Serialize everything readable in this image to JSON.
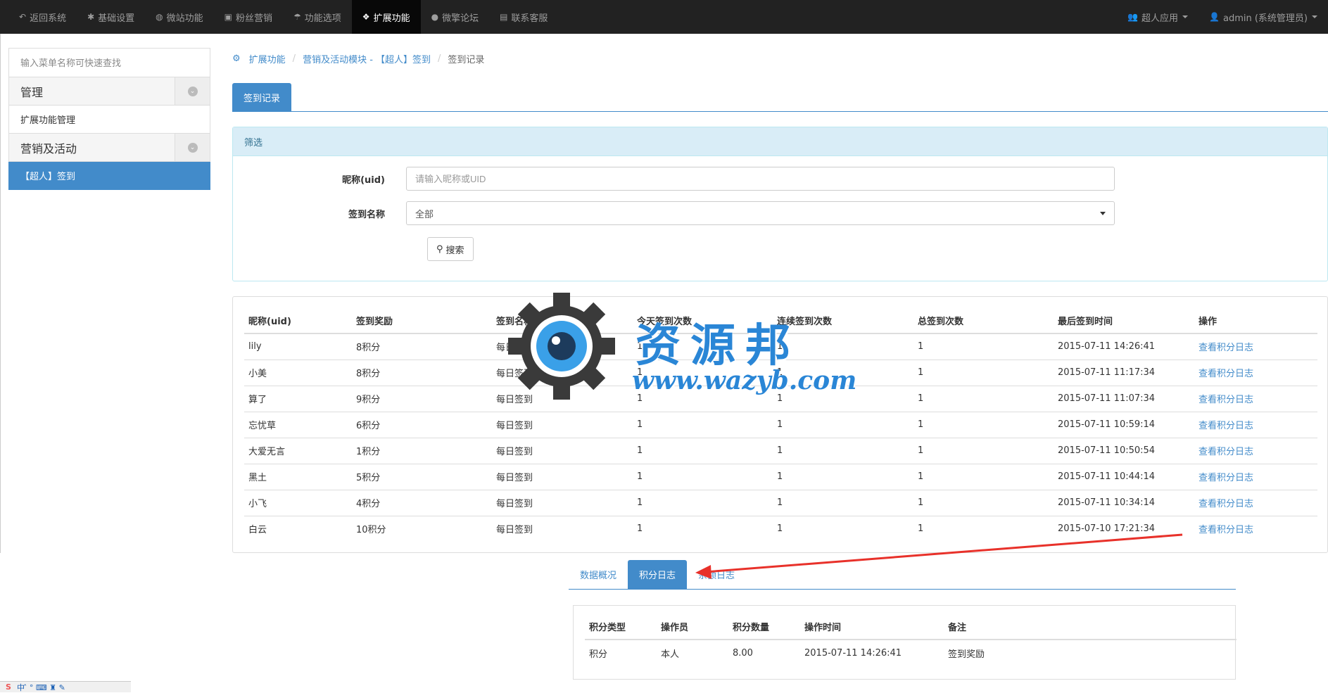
{
  "navbar": {
    "items": [
      {
        "icon": "reply-icon",
        "glyph": "↶",
        "label": "返回系统"
      },
      {
        "icon": "cog-icon",
        "glyph": "✱",
        "label": "基础设置"
      },
      {
        "icon": "globe-icon",
        "glyph": "◍",
        "label": "微站功能"
      },
      {
        "icon": "gift-icon",
        "glyph": "▣",
        "label": "粉丝营销"
      },
      {
        "icon": "umbrella-icon",
        "glyph": "☂",
        "label": "功能选项"
      },
      {
        "icon": "cubes-icon",
        "glyph": "❖",
        "label": "扩展功能"
      },
      {
        "icon": "comment-icon",
        "glyph": "●",
        "label": "微擎论坛"
      },
      {
        "icon": "briefcase-icon",
        "glyph": "▤",
        "label": "联系客服"
      }
    ],
    "active_index": 5,
    "right": {
      "app_label": "超人应用",
      "user_label": "admin (系统管理员)"
    }
  },
  "sidebar": {
    "search_placeholder": "输入菜单名称可快速查找",
    "groups": [
      {
        "title": "管理",
        "items": [
          {
            "label": "扩展功能管理",
            "active": false
          }
        ]
      },
      {
        "title": "营销及活动",
        "items": [
          {
            "label": "【超人】签到",
            "active": true
          }
        ]
      }
    ]
  },
  "breadcrumb": {
    "items": [
      "扩展功能",
      "营销及活动模块 - 【超人】签到"
    ],
    "current": "签到记录"
  },
  "tab": {
    "label": "签到记录"
  },
  "filter": {
    "heading": "筛选",
    "nickname_label": "昵称(uid)",
    "nickname_placeholder": "请输入昵称或UID",
    "name_label": "签到名称",
    "name_value": "全部",
    "search_button": "搜索"
  },
  "records": {
    "columns": [
      "昵称(uid)",
      "签到奖励",
      "签到名称",
      "今天签到次数",
      "连续签到次数",
      "总签到次数",
      "最后签到时间",
      "操作"
    ],
    "rows": [
      [
        "lily",
        "8积分",
        "每日签到",
        "1",
        "1",
        "1",
        "2015-07-11 14:26:41",
        "查看积分日志"
      ],
      [
        "小美",
        "8积分",
        "每日签到",
        "1",
        "1",
        "1",
        "2015-07-11 11:17:34",
        "查看积分日志"
      ],
      [
        "算了",
        "9积分",
        "每日签到",
        "1",
        "1",
        "1",
        "2015-07-11 11:07:34",
        "查看积分日志"
      ],
      [
        "忘忧草",
        "6积分",
        "每日签到",
        "1",
        "1",
        "1",
        "2015-07-11 10:59:14",
        "查看积分日志"
      ],
      [
        "大爱无言",
        "1积分",
        "每日签到",
        "1",
        "1",
        "1",
        "2015-07-11 10:50:54",
        "查看积分日志"
      ],
      [
        "黑土",
        "5积分",
        "每日签到",
        "1",
        "1",
        "1",
        "2015-07-11 10:44:14",
        "查看积分日志"
      ],
      [
        "小飞",
        "4积分",
        "每日签到",
        "1",
        "1",
        "1",
        "2015-07-11 10:34:14",
        "查看积分日志"
      ],
      [
        "白云",
        "10积分",
        "每日签到",
        "1",
        "1",
        "1",
        "2015-07-10 17:21:34",
        "查看积分日志"
      ]
    ]
  },
  "credit_log": {
    "tabs": [
      "数据概况",
      "积分日志",
      "余额日志"
    ],
    "active_tab": 1,
    "columns": [
      "积分类型",
      "操作员",
      "积分数量",
      "操作时间",
      "备注"
    ],
    "rows": [
      [
        "积分",
        "本人",
        "8.00",
        "2015-07-11 14:26:41",
        "签到奖励"
      ]
    ]
  },
  "watermark": {
    "title": "资源邦",
    "url": "www.wazyb.com"
  },
  "ime": {
    "text": "中 ̂ °  ⌨ ♜ ✎"
  },
  "colors": {
    "primary": "#428bca",
    "navbar": "#222222",
    "arrow": "#e8312a",
    "watermark": "#2a86d6"
  }
}
